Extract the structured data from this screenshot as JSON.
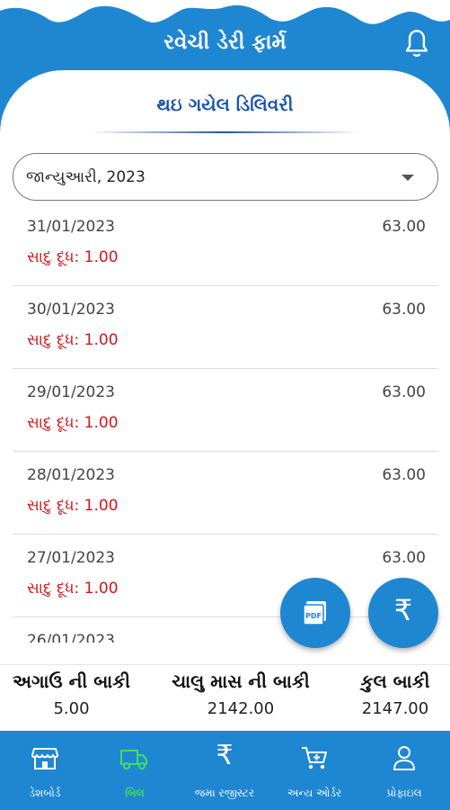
{
  "header": {
    "title": "રવેચી ડેરી ફાર્મ"
  },
  "card": {
    "title": "થઇ ગયેલ ડિલિવરી"
  },
  "month_select": {
    "value": "જાન્યુઆરી, 2023"
  },
  "deliveries": [
    {
      "date": "31/01/2023",
      "amount": "63.00",
      "detail": "સાદુ દૂધ: 1.00"
    },
    {
      "date": "30/01/2023",
      "amount": "63.00",
      "detail": "સાદુ દૂધ: 1.00"
    },
    {
      "date": "29/01/2023",
      "amount": "63.00",
      "detail": "સાદુ દૂધ: 1.00"
    },
    {
      "date": "28/01/2023",
      "amount": "63.00",
      "detail": "સાદુ દૂધ: 1.00"
    },
    {
      "date": "27/01/2023",
      "amount": "63.00",
      "detail": "સાદુ દૂધ: 1.00"
    },
    {
      "date": "26/01/2023",
      "amount": "",
      "detail": ""
    }
  ],
  "fab": {
    "pdf_icon": "pdf-icon",
    "rupee_symbol": "₹"
  },
  "summary": {
    "advance": {
      "label": "અગાઉ ની બાકી",
      "value": "5.00"
    },
    "current": {
      "label": "ચાલુ માસ ની બાકી",
      "value": "2142.00"
    },
    "total": {
      "label": "કુલ બાકી",
      "value": "2147.00"
    }
  },
  "nav": {
    "dashboard": "ડેશબોર્ડ",
    "bill": "બિલ",
    "deposit": "જમા રજીસ્ટર",
    "rupee_symbol": "₹",
    "other_order": "અન્ય ઓર્ડર",
    "profile": "પ્રોફાઇલ"
  },
  "colors": {
    "primary": "#1f87d2",
    "title": "#1a56a8",
    "detail": "#d0161b",
    "active_nav": "#3ee05a"
  }
}
